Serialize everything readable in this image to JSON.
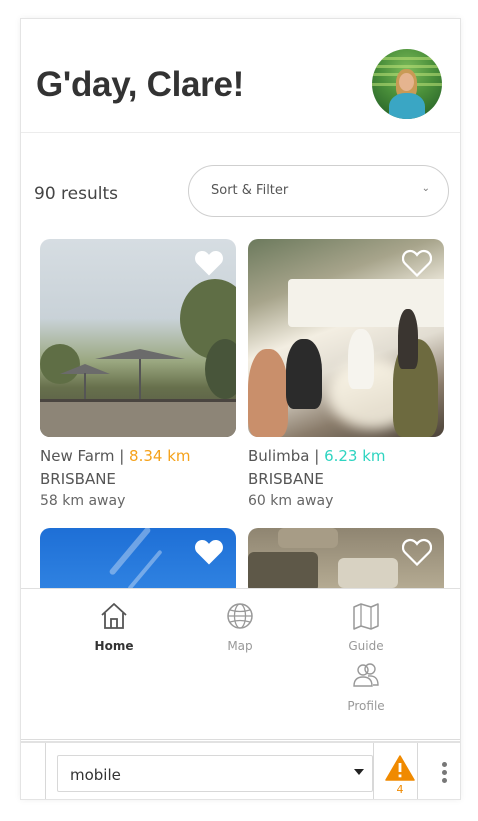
{
  "header": {
    "greeting": "G'day, Clare!"
  },
  "toolbar": {
    "results_count": "90 results",
    "sort_filter_label": "Sort & Filter"
  },
  "cards": [
    {
      "suburb": "New Farm",
      "separator": " | ",
      "distance": "8.34 km",
      "city": "BRISBANE",
      "away": "58 km away",
      "distance_color": "#f5a21b"
    },
    {
      "suburb": "Bulimba",
      "separator": " | ",
      "distance": "6.23 km",
      "city": "BRISBANE",
      "away": "60 km away",
      "distance_color": "#2fd4c1"
    }
  ],
  "nav": {
    "items": [
      {
        "label": "Home",
        "icon": "home-icon",
        "active": true
      },
      {
        "label": "Map",
        "icon": "globe-icon",
        "active": false
      },
      {
        "label": "Guide",
        "icon": "map-guide-icon",
        "active": false
      },
      {
        "label": "Profile",
        "icon": "users-icon",
        "active": false
      }
    ]
  },
  "devbar": {
    "device_select": "mobile",
    "warning_count": "4"
  },
  "colors": {
    "accent_orange": "#f5a21b",
    "accent_teal": "#2fd4c1",
    "warning": "#f08a00"
  }
}
